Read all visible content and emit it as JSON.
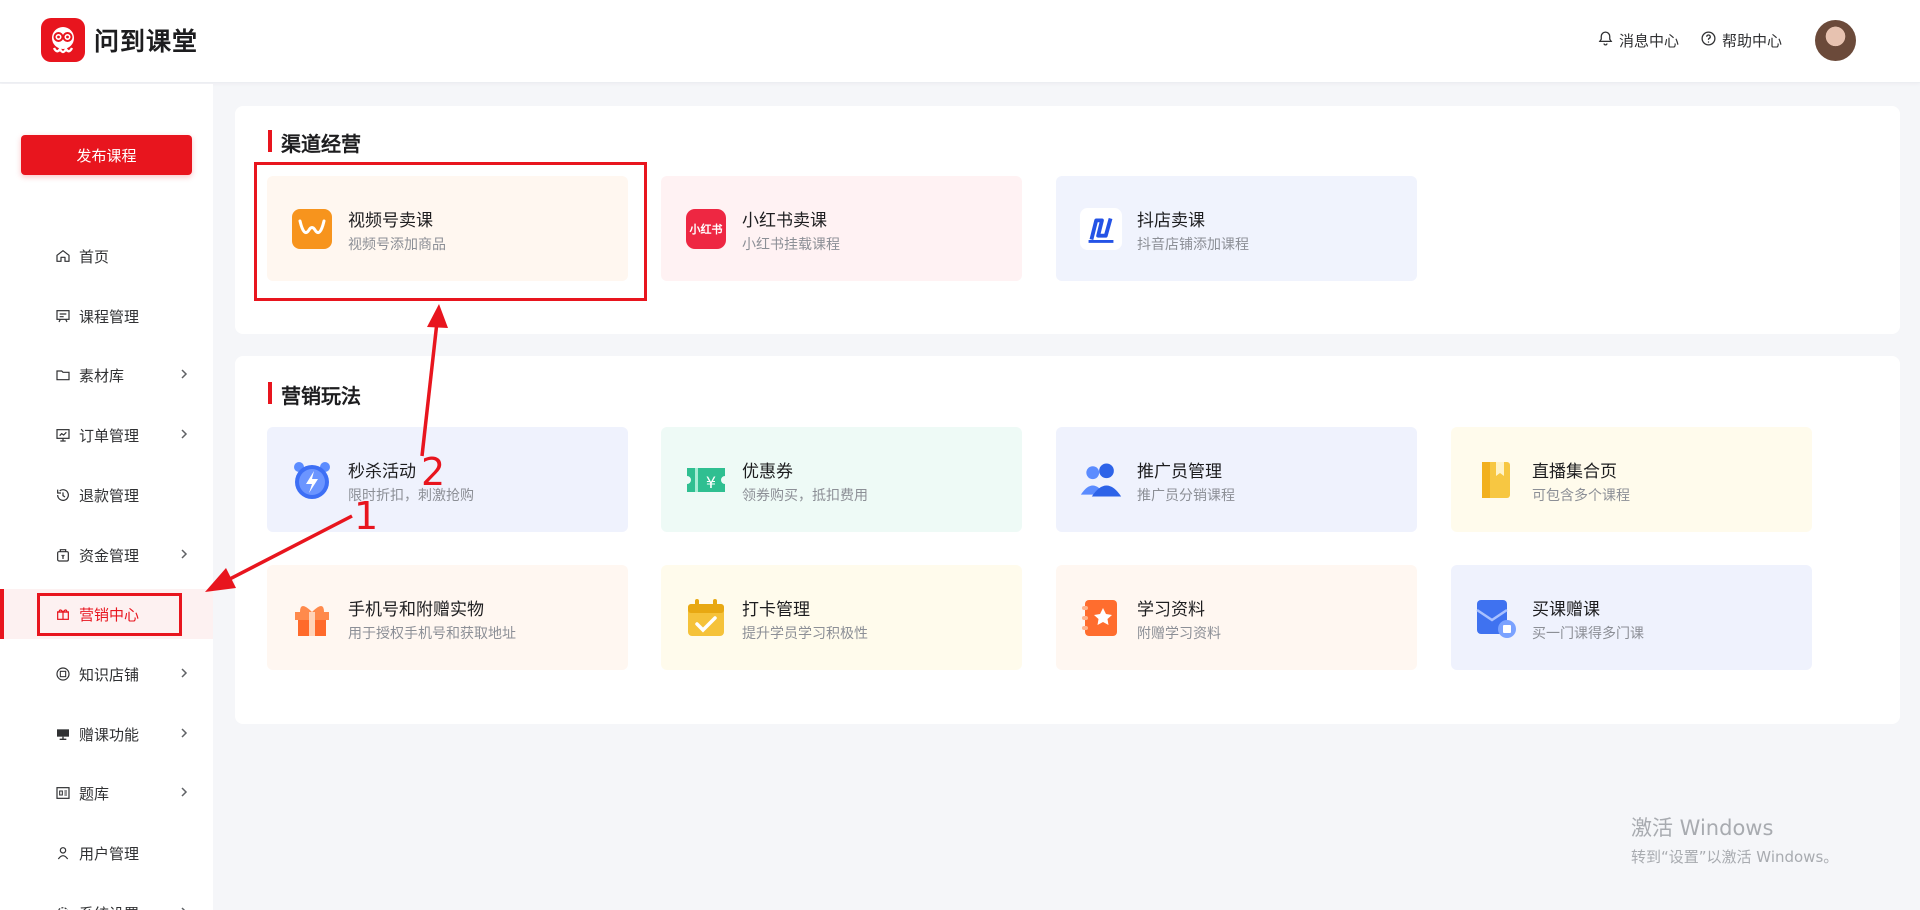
{
  "header": {
    "brand": "问到课堂",
    "messages": "消息中心",
    "help": "帮助中心"
  },
  "sidebar": {
    "publish": "发布课程",
    "items": [
      {
        "label": "首页",
        "icon": "home-icon",
        "chevron": false
      },
      {
        "label": "课程管理",
        "icon": "course-icon",
        "chevron": false
      },
      {
        "label": "素材库",
        "icon": "folder-icon",
        "chevron": true
      },
      {
        "label": "订单管理",
        "icon": "order-icon",
        "chevron": true
      },
      {
        "label": "退款管理",
        "icon": "refund-icon",
        "chevron": false
      },
      {
        "label": "资金管理",
        "icon": "wallet-icon",
        "chevron": true
      },
      {
        "label": "营销中心",
        "icon": "gift-icon",
        "chevron": false,
        "active": true
      },
      {
        "label": "知识店铺",
        "icon": "shop-icon",
        "chevron": true
      },
      {
        "label": "赠课功能",
        "icon": "present-icon",
        "chevron": true
      },
      {
        "label": "题库",
        "icon": "question-bank-icon",
        "chevron": true
      },
      {
        "label": "用户管理",
        "icon": "user-icon",
        "chevron": false
      },
      {
        "label": "系统设置",
        "icon": "settings-icon",
        "chevron": true
      }
    ]
  },
  "channel": {
    "title": "渠道经营",
    "cards": [
      {
        "title": "视频号卖课",
        "desc": "视频号添加商品"
      },
      {
        "title": "小红书卖课",
        "desc": "小红书挂载课程",
        "icon_text": "小红书"
      },
      {
        "title": "抖店卖课",
        "desc": "抖音店铺添加课程"
      }
    ]
  },
  "marketing": {
    "title": "营销玩法",
    "cards": [
      {
        "title": "秒杀活动",
        "desc": "限时折扣，刺激抢购"
      },
      {
        "title": "优惠券",
        "desc": "领券购买，抵扣费用"
      },
      {
        "title": "推广员管理",
        "desc": "推广员分销课程"
      },
      {
        "title": "直播集合页",
        "desc": "可包含多个课程"
      },
      {
        "title": "手机号和附赠实物",
        "desc": "用于授权手机号和获取地址"
      },
      {
        "title": "打卡管理",
        "desc": "提升学员学习积极性"
      },
      {
        "title": "学习资料",
        "desc": "附赠学习资料"
      },
      {
        "title": "买课赠课",
        "desc": "买一门课得多门课"
      }
    ]
  },
  "annotations": {
    "one": "1",
    "two": "2"
  },
  "watermark": {
    "line1": "激活 Windows",
    "line2": "转到“设置”以激活 Windows。"
  },
  "colors": {
    "accent": "#e8151e"
  }
}
